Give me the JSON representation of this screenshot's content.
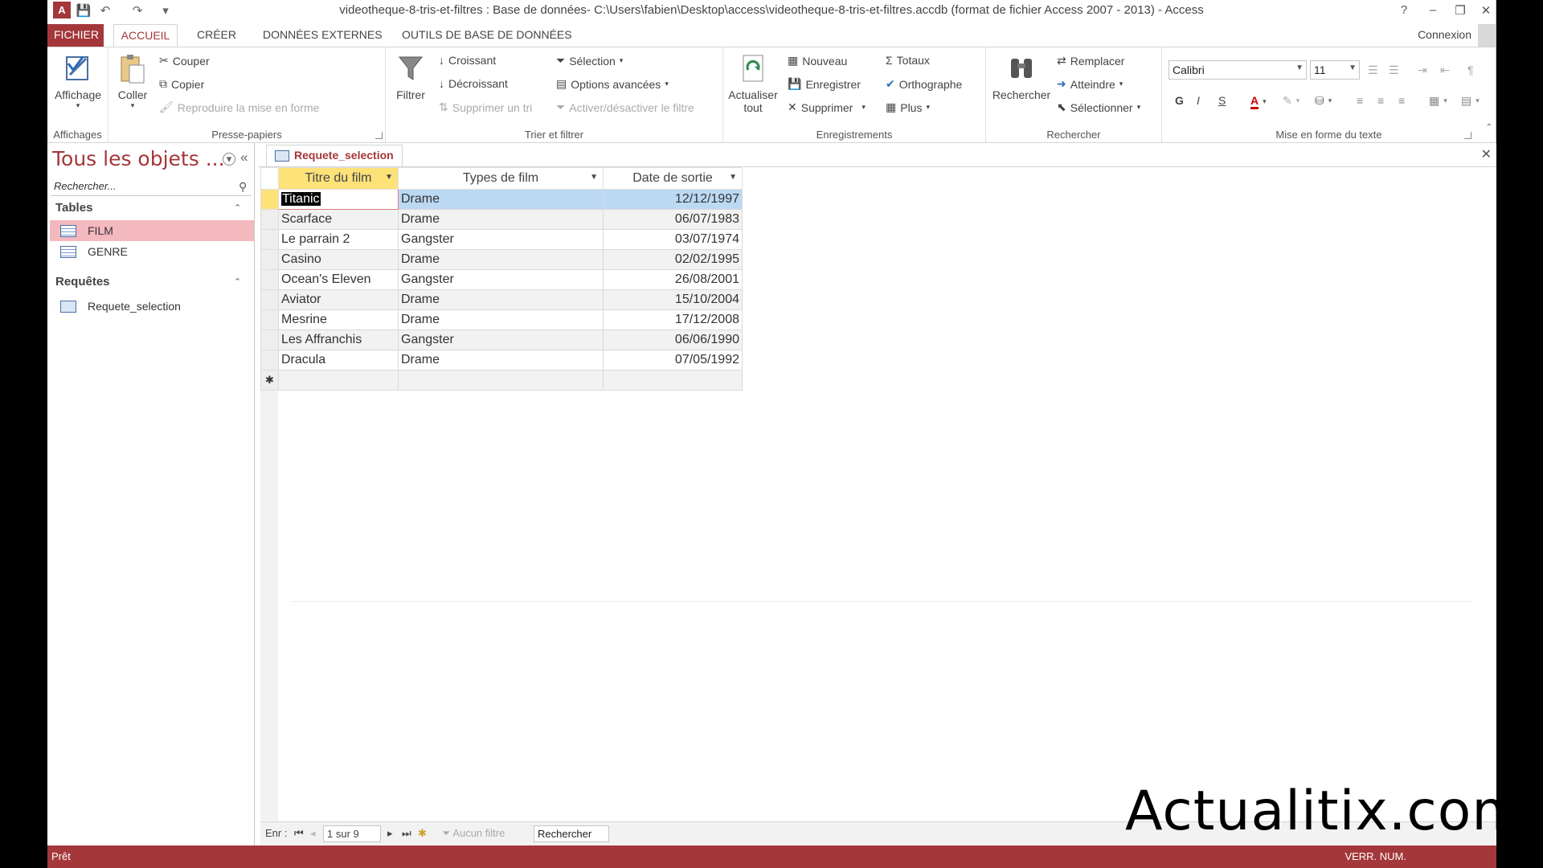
{
  "window": {
    "title": "videotheque-8-tris-et-filtres : Base de données- C:\\Users\\fabien\\Desktop\\access\\videotheque-8-tris-et-filtres.accdb (format de fichier Access 2007 - 2013) - Access",
    "logo": "A",
    "help": "?",
    "minimize": "–",
    "restore": "❐",
    "close": "✕"
  },
  "tabs": {
    "file": "FICHIER",
    "home": "ACCUEIL",
    "create": "CRÉER",
    "external": "DONNÉES EXTERNES",
    "tools": "OUTILS DE BASE DE DONNÉES",
    "connexion": "Connexion"
  },
  "ribbon": {
    "views": {
      "label": "Affichages",
      "view_btn": "Affichage"
    },
    "clipboard": {
      "label": "Presse-papiers",
      "paste": "Coller",
      "cut": "Couper",
      "copy": "Copier",
      "format_painter": "Reproduire la mise en forme"
    },
    "sort_filter": {
      "label": "Trier et filtrer",
      "filter": "Filtrer",
      "ascending": "Croissant",
      "descending": "Décroissant",
      "remove_sort": "Supprimer un tri",
      "selection": "Sélection",
      "advanced": "Options avancées",
      "toggle_filter": "Activer/désactiver le filtre"
    },
    "records": {
      "label": "Enregistrements",
      "refresh_line1": "Actualiser",
      "refresh_line2": "tout",
      "new": "Nouveau",
      "save": "Enregistrer",
      "delete": "Supprimer",
      "totals": "Totaux",
      "spelling": "Orthographe",
      "more": "Plus"
    },
    "find": {
      "label": "Rechercher",
      "find": "Rechercher",
      "replace": "Remplacer",
      "goto": "Atteindre",
      "select": "Sélectionner"
    },
    "text_format": {
      "label": "Mise en forme du texte",
      "font": "Calibri",
      "size": "11",
      "bold": "G",
      "italic": "I",
      "underline": "S"
    }
  },
  "nav": {
    "title": "Tous les objets ...",
    "search_placeholder": "Rechercher...",
    "tables_header": "Tables",
    "tables": [
      "FILM",
      "GENRE"
    ],
    "queries_header": "Requêtes",
    "queries": [
      "Requete_selection"
    ]
  },
  "document": {
    "tab_label": "Requete_selection",
    "columns": [
      "Titre du film",
      "Types de film",
      "Date de sortie"
    ],
    "rows": [
      [
        "Titanic",
        "Drame",
        "12/12/1997"
      ],
      [
        "Scarface",
        "Drame",
        "06/07/1983"
      ],
      [
        "Le parrain 2",
        "Gangster",
        "03/07/1974"
      ],
      [
        "Casino",
        "Drame",
        "02/02/1995"
      ],
      [
        "Ocean's Eleven",
        "Gangster",
        "26/08/2001"
      ],
      [
        "Aviator",
        "Drame",
        "15/10/2004"
      ],
      [
        "Mesrine",
        "Drame",
        "17/12/2008"
      ],
      [
        "Les Affranchis",
        "Gangster",
        "06/06/1990"
      ],
      [
        "Dracula",
        "Drame",
        "07/05/1992"
      ]
    ],
    "new_row_marker": "✱"
  },
  "record_nav": {
    "label": "Enr :",
    "position": "1 sur 9",
    "no_filter": "Aucun filtre",
    "search": "Rechercher"
  },
  "status": {
    "left": "Prêt",
    "right": "VERR. NUM."
  },
  "watermark": "Actualitix.com",
  "colors": {
    "accent": "#a4373a",
    "header_selected": "#fde27a",
    "cell_highlight": "#bcd9f4",
    "nav_selected": "#f4b8bf"
  }
}
